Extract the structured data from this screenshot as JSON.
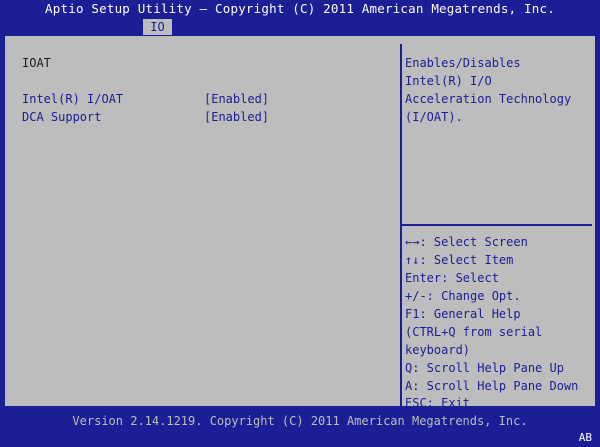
{
  "header": {
    "title": "Aptio Setup Utility – Copyright (C) 2011 American Megatrends, Inc.",
    "active_tab": "IO"
  },
  "main": {
    "section_title": "IOAT",
    "options": [
      {
        "label": "Intel(R) I/OAT",
        "value": "[Enabled]"
      },
      {
        "label": "DCA Support",
        "value": "[Enabled]"
      }
    ]
  },
  "help": {
    "lines": [
      "Enables/Disables",
      "Intel(R) I/O",
      "Acceleration Technology",
      "(I/OAT)."
    ]
  },
  "keys": [
    {
      "key": "←→",
      "text": ": Select Screen"
    },
    {
      "key": "↑↓",
      "text": ": Select Item"
    },
    {
      "key": "",
      "text": "Enter: Select"
    },
    {
      "key": "",
      "text": "+/-: Change Opt."
    },
    {
      "key": "",
      "text": "F1: General Help"
    },
    {
      "key": "",
      "text": "(CTRL+Q from serial"
    },
    {
      "key": "",
      "text": "keyboard)"
    },
    {
      "key": "",
      "text": "Q: Scroll Help Pane Up"
    },
    {
      "key": "",
      "text": "A: Scroll Help Pane Down"
    },
    {
      "key": "",
      "text": "ESC: Exit"
    }
  ],
  "footer": {
    "text": "Version 2.14.1219. Copyright (C) 2011 American Megatrends, Inc.",
    "corner": "AB"
  },
  "colors": {
    "background": "#1b1e94",
    "panel": "#bdbdbd",
    "highlight_text": "#ffffff"
  }
}
